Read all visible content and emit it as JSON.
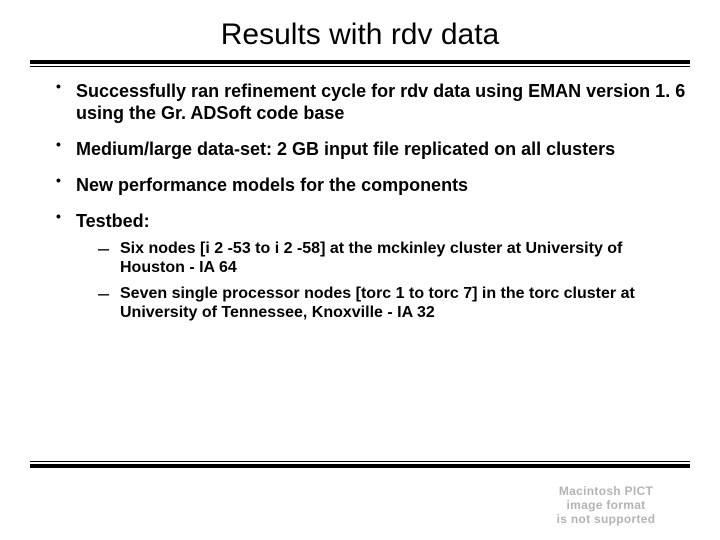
{
  "title": "Results with rdv data",
  "bullets": [
    "Successfully ran refinement cycle for rdv data using EMAN version 1. 6 using the Gr. ADSoft code base",
    "Medium/large data-set: 2 GB input file replicated on all clusters",
    "New performance models for the components",
    "Testbed:"
  ],
  "sub_bullets": [
    " Six nodes [i 2 -53 to i 2 -58] at the mckinley cluster at University of Houston - IA 64",
    " Seven single processor nodes [torc 1 to torc 7] in the torc cluster at University of Tennessee, Knoxville - IA 32"
  ],
  "pict": {
    "l1": "Macintosh PICT",
    "l2": "image format",
    "l3": "is not supported"
  }
}
